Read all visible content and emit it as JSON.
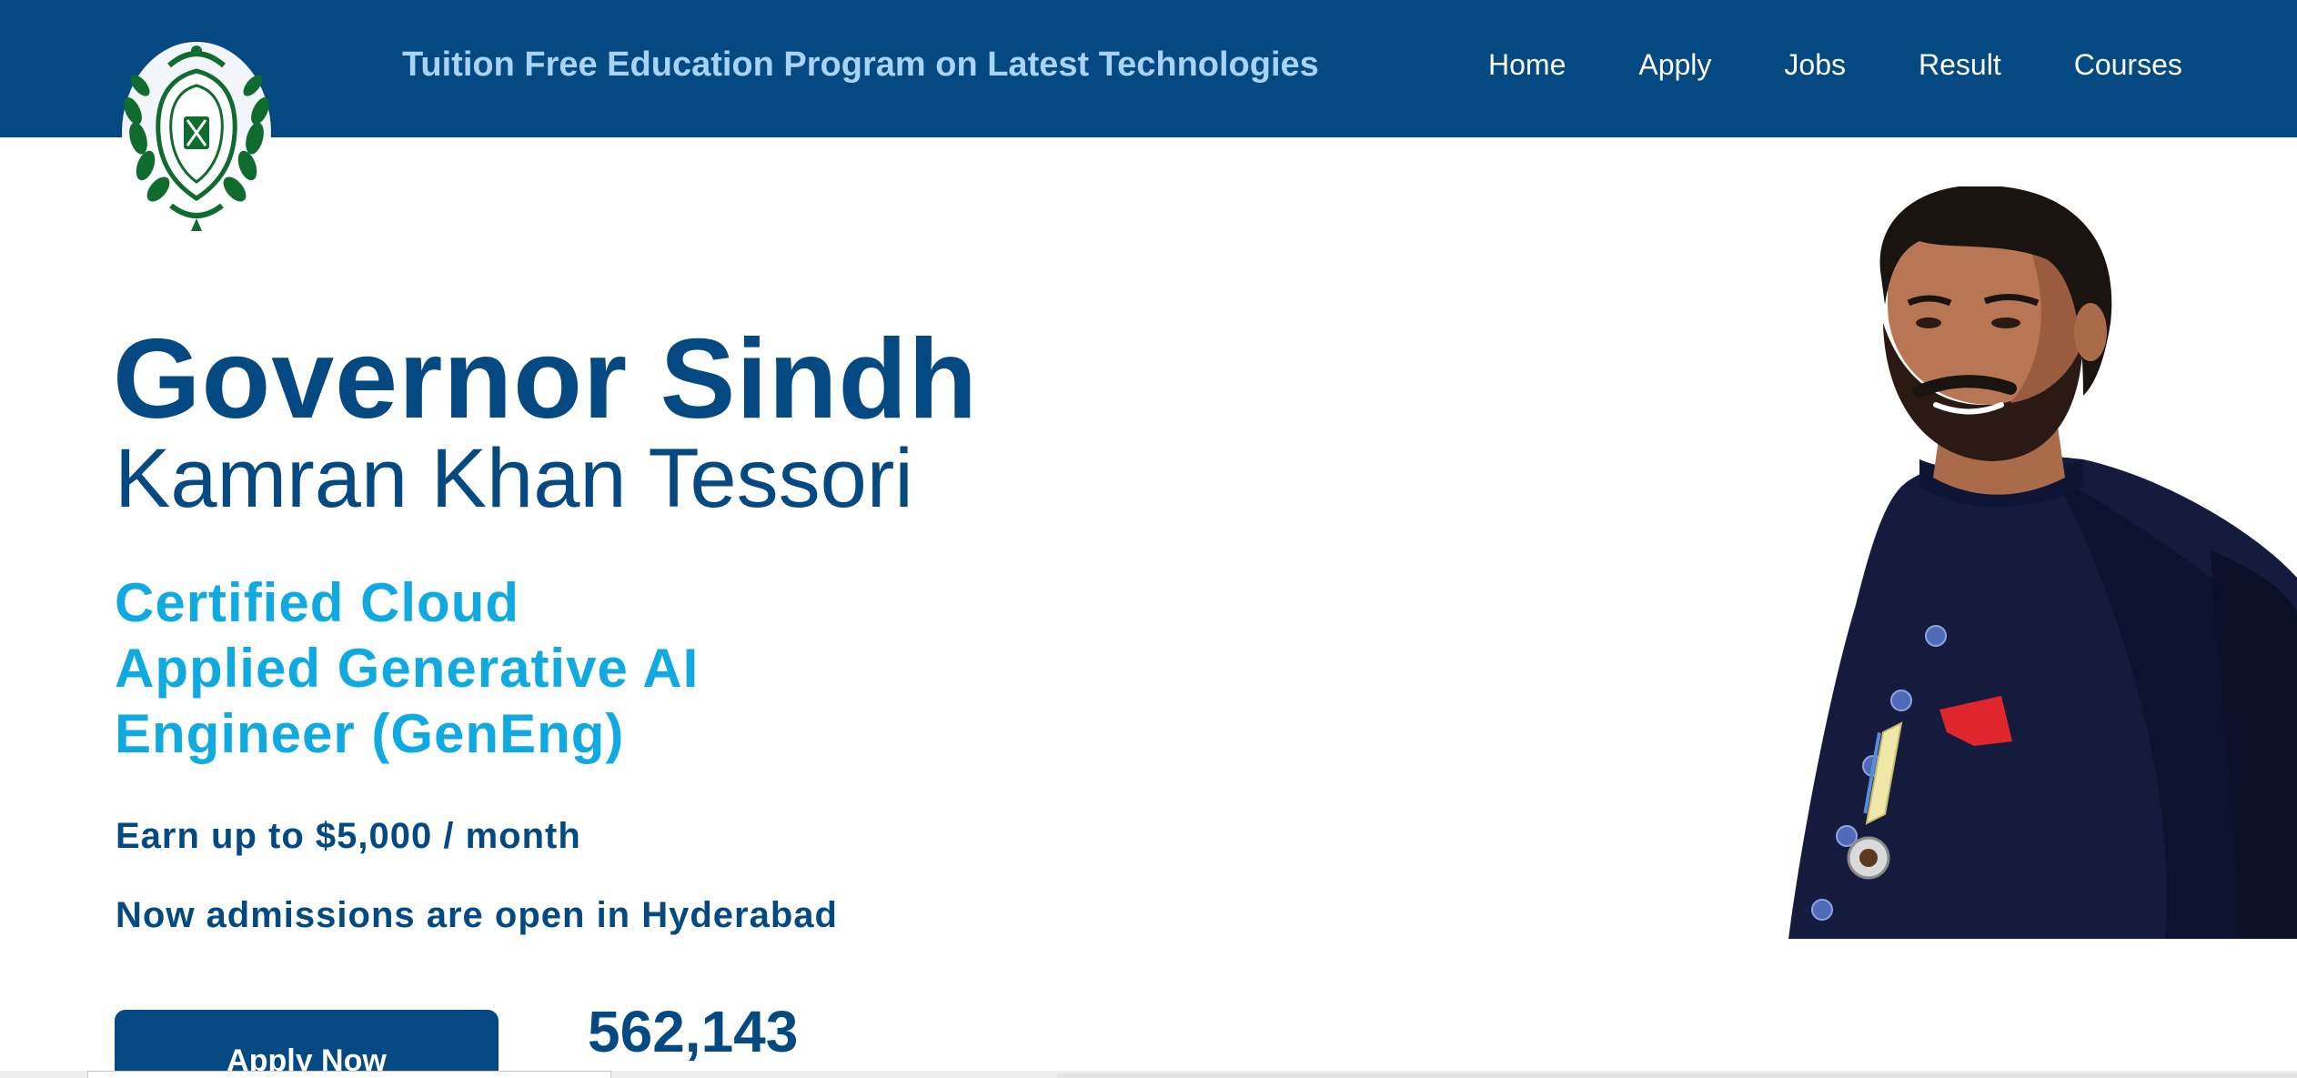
{
  "header": {
    "program_title": "Tuition Free Education Program on Latest Technologies",
    "nav": [
      {
        "label": "Home"
      },
      {
        "label": "Apply"
      },
      {
        "label": "Jobs"
      },
      {
        "label": "Result"
      },
      {
        "label": "Courses"
      }
    ]
  },
  "hero": {
    "title": "Governor Sindh",
    "name": "Kamran Khan Tessori",
    "program_lines": [
      "Certified Cloud",
      "Applied Generative AI",
      "Engineer (GenEng)"
    ],
    "earn": "Earn up to $5,000 / month",
    "admissions": "Now admissions are open in Hyderabad",
    "apply_button": "Apply Now",
    "counter": "562,143"
  },
  "colors": {
    "header_bg": "#044982",
    "title_text": "#a9d3f5",
    "primary_text": "#044982",
    "accent_text": "#10a9e0",
    "logo_green": "#0f6b2e"
  },
  "icons": {
    "logo": "governor-sindh-emblem-icon",
    "portrait": "governor-portrait"
  }
}
